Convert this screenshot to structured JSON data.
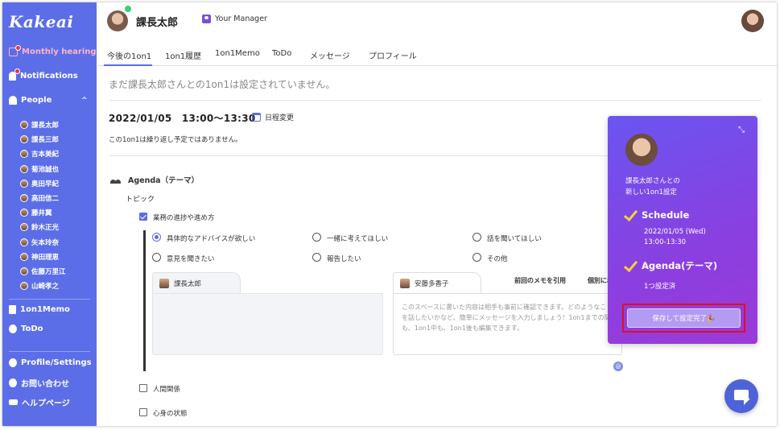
{
  "app": {
    "logo": "Kakeai"
  },
  "sidebar": {
    "monthly_hearing": "Monthly hearing",
    "notifications": "Notifications",
    "people": "People",
    "people_list": [
      "課長太郎",
      "課長三郎",
      "吉本美紀",
      "菊池誠也",
      "奥田早紀",
      "高田信二",
      "藤井翼",
      "鈴木正光",
      "矢本玲奈",
      "神田理恵",
      "佐藤万里江",
      "山崎孝之"
    ],
    "memo": "1on1Memo",
    "todo": "ToDo",
    "profile_settings": "Profile/Settings",
    "contact": "お問い合わせ",
    "help": "ヘルプページ"
  },
  "header": {
    "name": "課長太郎",
    "role_tag": "Your Manager"
  },
  "tabs": [
    "今後の1on1",
    "1on1履歴",
    "1on1Memo",
    "ToDo",
    "メッセージ",
    "プロフィール"
  ],
  "main": {
    "notice": "まだ課長太郎さんとの1on1は設定されていません。",
    "datetime": "2022/01/05　13:00〜13:30",
    "reschedule": "日程変更",
    "repeat_note": "この1on1は繰り返し予定ではありません。",
    "agenda_title": "Agenda（テーマ）",
    "topic_label": "トピック",
    "topic_checked": "業務の進捗や進め方",
    "radios": [
      "具体的なアドバイスが欲しい",
      "一緒に考えてほしい",
      "話を聞いてほしい",
      "意見を聞きたい",
      "報告したい",
      "その他"
    ],
    "memo_left_name": "課長太郎",
    "memo_right_name": "安藤多香子",
    "memo_quote": "前回のメモを引用",
    "memo_individual": "個別に着",
    "memo_placeholder": "このスペースに書いた内容は相手も事前に確認できます。どのようなことを話したいかなど、簡単にメッセージを入力しましょう！1on1までの間も、1on1中も、1on1後も編集できます。",
    "topic_human": "人間関係",
    "topic_mind": "心身の状態"
  },
  "panel": {
    "line1": "課長太郎さんとの",
    "line2": "新しい1on1設定",
    "schedule_head": "Schedule",
    "schedule_date": "2022/01/05 (Wed)",
    "schedule_time": "13:00-13:30",
    "agenda_head": "Agenda(テーマ)",
    "agenda_count": "1つ設定済",
    "save_button": "保存して設定完了🎉"
  }
}
